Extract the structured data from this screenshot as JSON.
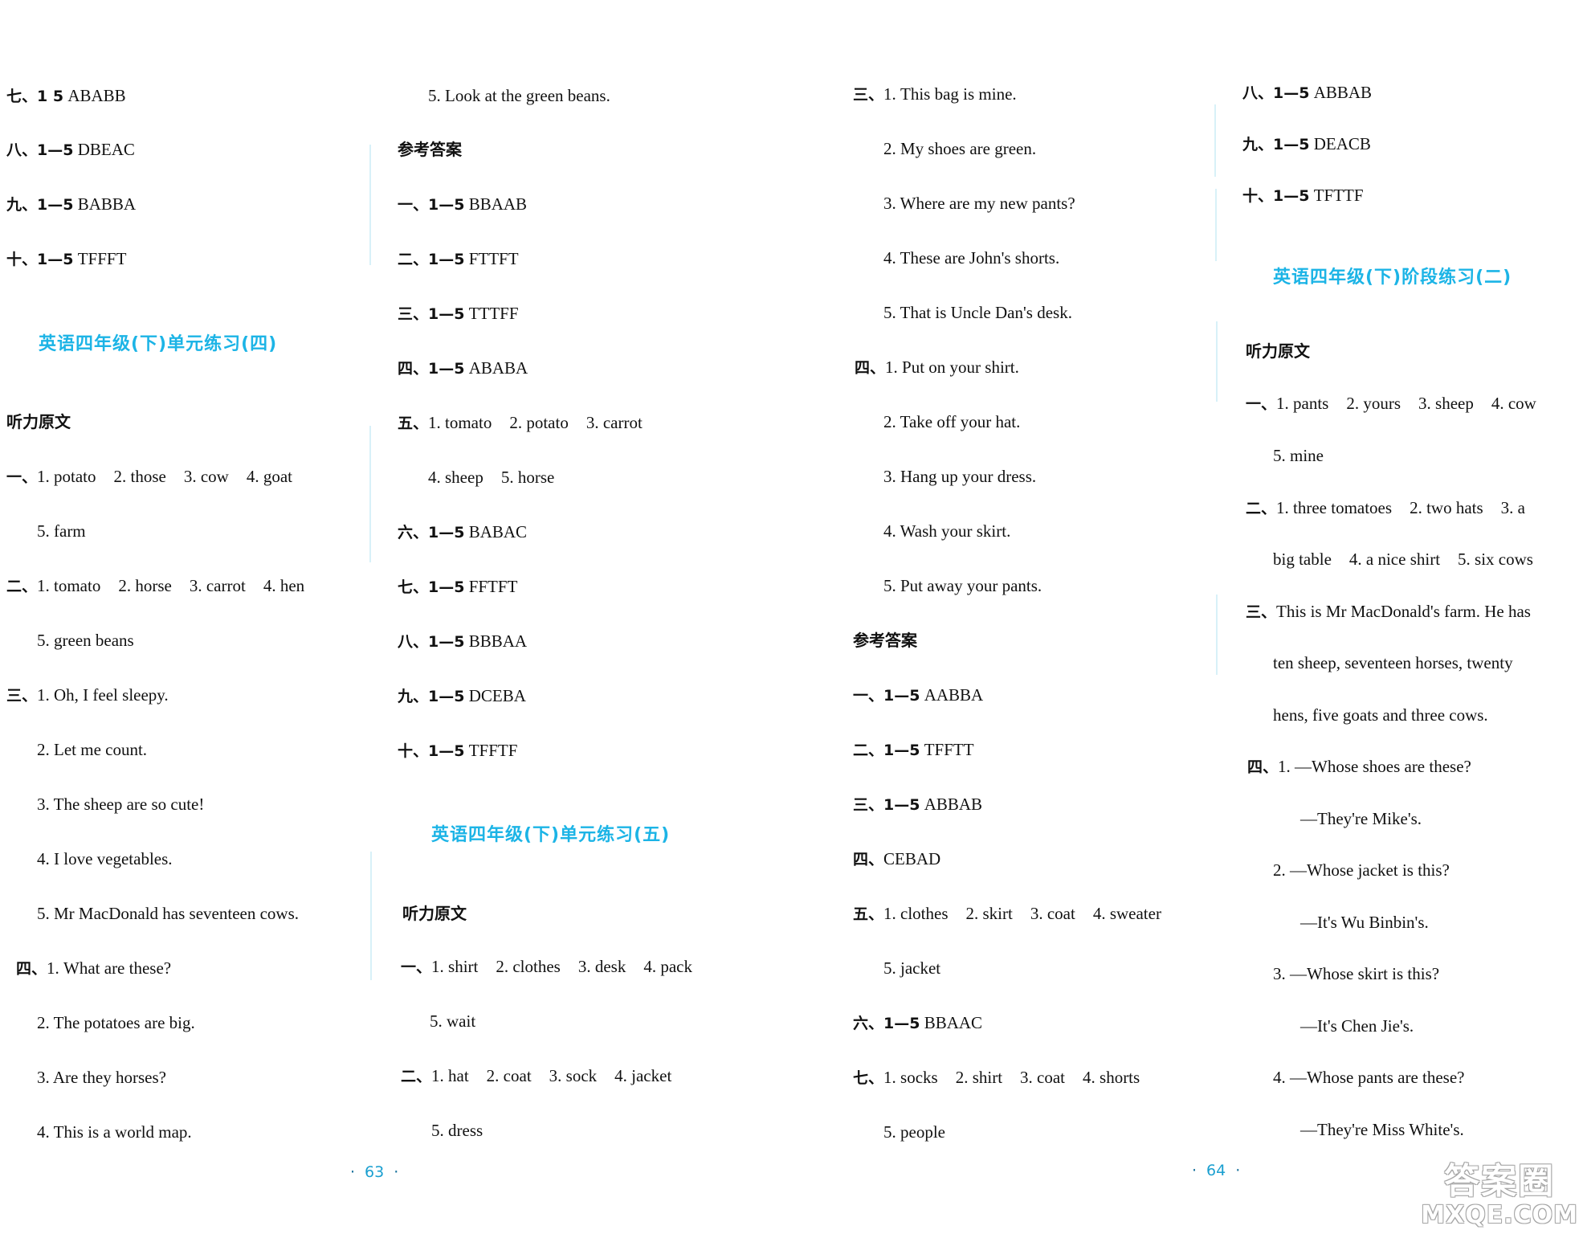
{
  "pages": [
    {
      "number": "63"
    },
    {
      "number": "64"
    }
  ],
  "col1": {
    "lines": [
      {
        "label": "七、1 5",
        "text": "ABABB"
      },
      {
        "label": "八、1—5",
        "text": "DBEAC"
      },
      {
        "label": "九、1—5",
        "text": "BABBA"
      },
      {
        "label": "十、1—5",
        "text": "TFFFT"
      }
    ],
    "section_title": "英语四年级(下)单元练习(四)",
    "listening_heading": "听力原文",
    "q1": {
      "label": "一、",
      "items": [
        "1. potato",
        "2. those",
        "3. cow",
        "4. goat"
      ],
      "cont": "5. farm"
    },
    "q2": {
      "label": "二、",
      "items": [
        "1. tomato",
        "2. horse",
        "3. carrot",
        "4. hen"
      ],
      "cont": "5. green beans"
    },
    "q3": {
      "label": "三、",
      "lines": [
        "1. Oh, I feel sleepy.",
        "2. Let me count.",
        "3. The sheep are so cute!",
        "4. I love vegetables.",
        "5. Mr MacDonald has seventeen cows."
      ]
    },
    "q4": {
      "label": "四、",
      "lines": [
        "1. What are these?",
        "2. The potatoes are big.",
        "3. Are they horses?",
        "4. This is a world map."
      ]
    }
  },
  "col2": {
    "first_line": "5. Look at the green beans.",
    "answers_heading": "参考答案",
    "answers": [
      {
        "label": "一、1—5",
        "text": "BBAAB"
      },
      {
        "label": "二、1—5",
        "text": "FTTFT"
      },
      {
        "label": "三、1—5",
        "text": "TTTFF"
      },
      {
        "label": "四、1—5",
        "text": "ABABA"
      }
    ],
    "q5": {
      "label": "五、",
      "items": [
        "1. tomato",
        "2. potato",
        "3. carrot"
      ],
      "cont": [
        "4. sheep",
        "5. horse"
      ]
    },
    "answers2": [
      {
        "label": "六、1—5",
        "text": "BABAC"
      },
      {
        "label": "七、1—5",
        "text": "FFTFT"
      },
      {
        "label": "八、1—5",
        "text": "BBBAA"
      },
      {
        "label": "九、1—5",
        "text": "DCEBA"
      },
      {
        "label": "十、1—5",
        "text": "TFFTF"
      }
    ],
    "section_title": "英语四年级(下)单元练习(五)",
    "listening_heading": "听力原文",
    "q1": {
      "label": "一、",
      "items": [
        "1. shirt",
        "2. clothes",
        "3. desk",
        "4. pack"
      ],
      "cont": "5. wait"
    },
    "q2": {
      "label": "二、",
      "items": [
        "1. hat",
        "2. coat",
        "3. sock",
        "4. jacket"
      ],
      "cont": "5. dress"
    }
  },
  "col3": {
    "q3": {
      "label": "三、",
      "lines": [
        "1. This bag is mine.",
        "2. My shoes are green.",
        "3. Where are my new pants?",
        "4. These are John's shorts.",
        "5. That is Uncle Dan's desk."
      ]
    },
    "q4": {
      "label": "四、",
      "lines": [
        "1. Put on your shirt.",
        "2. Take off your hat.",
        "3. Hang up your dress.",
        "4. Wash your skirt.",
        "5. Put away your pants."
      ]
    },
    "answers_heading": "参考答案",
    "answers": [
      {
        "label": "一、1—5",
        "text": "AABBA"
      },
      {
        "label": "二、1—5",
        "text": "TFFTT"
      },
      {
        "label": "三、1—5",
        "text": "ABBAB"
      },
      {
        "label": "四、",
        "text": "CEBAD"
      }
    ],
    "q5": {
      "label": "五、",
      "items": [
        "1. clothes",
        "2. skirt",
        "3. coat",
        "4. sweater"
      ],
      "cont": "5. jacket"
    },
    "a6": {
      "label": "六、1—5",
      "text": "BBAAC"
    },
    "q7": {
      "label": "七、",
      "items": [
        "1. socks",
        "2. shirt",
        "3. coat",
        "4. shorts"
      ],
      "cont": "5. people"
    }
  },
  "col4": {
    "answers": [
      {
        "label": "八、1—5",
        "text": "ABBAB"
      },
      {
        "label": "九、1—5",
        "text": "DEACB"
      },
      {
        "label": "十、1—5",
        "text": "TFTTF"
      }
    ],
    "section_title": "英语四年级(下)阶段练习(二)",
    "listening_heading": "听力原文",
    "q1": {
      "label": "一、",
      "items": [
        "1. pants",
        "2. yours",
        "3. sheep",
        "4. cow"
      ],
      "cont": "5. mine"
    },
    "q2": {
      "label": "二、",
      "line1": [
        "1. three tomatoes",
        "2. two hats",
        "3. a"
      ],
      "line2": [
        "big table",
        "4. a nice shirt",
        "5. six cows"
      ]
    },
    "q3": {
      "label": "三、",
      "lines": [
        "This is Mr MacDonald's farm. He has",
        "ten sheep, seventeen horses, twenty",
        "hens, five goats and three cows."
      ]
    },
    "q4": {
      "label": "四、",
      "lines": [
        "1. —Whose shoes are these?",
        "—They're Mike's.",
        "2. —Whose jacket is this?",
        "—It's Wu Binbin's.",
        "3. —Whose skirt is this?",
        "—It's Chen Jie's.",
        "4. —Whose pants are these?",
        "—They're Miss White's."
      ]
    }
  },
  "watermark": {
    "line1": "答案圈",
    "line2": "MXQE.COM"
  },
  "colors": {
    "title": "#1cb4e6",
    "page_number": "#1a9fd0",
    "text": "#111111"
  }
}
